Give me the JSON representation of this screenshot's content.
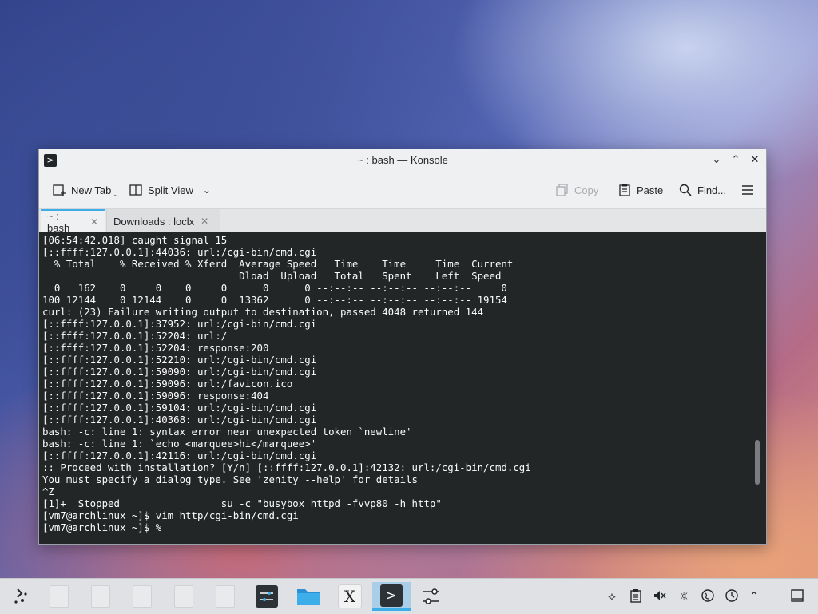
{
  "window": {
    "title": "~ : bash — Konsole",
    "app_icon": "terminal-icon"
  },
  "toolbar": {
    "new_tab": "New Tab",
    "split_view": "Split View",
    "copy": "Copy",
    "paste": "Paste",
    "find": "Find..."
  },
  "tabs": [
    {
      "label": "~ : bash",
      "active": true
    },
    {
      "label": "Downloads : loclx",
      "active": false
    }
  ],
  "terminal": {
    "lines": [
      "[06:54:42.018] caught signal 15",
      "[::ffff:127.0.0.1]:44036: url:/cgi-bin/cmd.cgi",
      "  % Total    % Received % Xferd  Average Speed   Time    Time     Time  Current",
      "                                 Dload  Upload   Total   Spent    Left  Speed",
      "  0   162    0     0    0     0      0      0 --:--:-- --:--:-- --:--:--     0",
      "100 12144    0 12144    0     0  13362      0 --:--:-- --:--:-- --:--:-- 19154",
      "curl: (23) Failure writing output to destination, passed 4048 returned 144",
      "[::ffff:127.0.0.1]:37952: url:/cgi-bin/cmd.cgi",
      "[::ffff:127.0.0.1]:52204: url:/",
      "[::ffff:127.0.0.1]:52204: response:200",
      "[::ffff:127.0.0.1]:52210: url:/cgi-bin/cmd.cgi",
      "[::ffff:127.0.0.1]:59090: url:/cgi-bin/cmd.cgi",
      "[::ffff:127.0.0.1]:59096: url:/favicon.ico",
      "[::ffff:127.0.0.1]:59096: response:404",
      "[::ffff:127.0.0.1]:59104: url:/cgi-bin/cmd.cgi",
      "[::ffff:127.0.0.1]:40368: url:/cgi-bin/cmd.cgi",
      "bash: -c: line 1: syntax error near unexpected token `newline'",
      "bash: -c: line 1: `echo <marquee>hi</marquee>'",
      "[::ffff:127.0.0.1]:42116: url:/cgi-bin/cmd.cgi",
      ":: Proceed with installation? [Y/n] [::ffff:127.0.0.1]:42132: url:/cgi-bin/cmd.cgi",
      "You must specify a dialog type. See 'zenity --help' for details",
      "^Z",
      "[1]+  Stopped                 su -c \"busybox httpd -fvvp80 -h http\"",
      "[vm7@archlinux ~]$ vim http/cgi-bin/cmd.cgi",
      "[vm7@archlinux ~]$ %"
    ]
  },
  "taskbar": {
    "launcher_icon": "app-launcher-icon",
    "items": [
      {
        "icon": "document-icon",
        "active": false
      },
      {
        "icon": "document-icon",
        "active": false
      },
      {
        "icon": "document-icon",
        "active": false
      },
      {
        "icon": "document-icon",
        "active": false
      },
      {
        "icon": "document-icon",
        "active": false
      },
      {
        "icon": "settings-panel-icon",
        "active": false
      },
      {
        "icon": "folder-icon",
        "active": false
      },
      {
        "icon": "xorg-icon",
        "active": false
      },
      {
        "icon": "terminal-icon",
        "active": true
      },
      {
        "icon": "sliders-icon",
        "active": false
      }
    ],
    "tray": [
      "network-icon",
      "clipboard-icon",
      "volume-muted-icon",
      "brightness-icon",
      "globe-icon",
      "timer-icon",
      "expand-tray-icon",
      "show-desktop-icon"
    ]
  },
  "colors": {
    "accent": "#3daee9",
    "terminal_bg": "#232627",
    "terminal_fg": "#fcfcfc"
  }
}
